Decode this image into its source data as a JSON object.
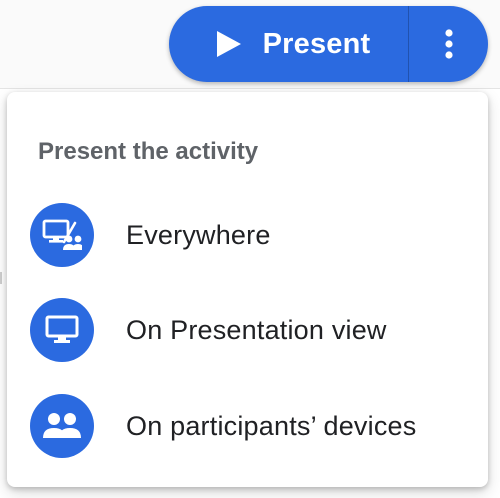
{
  "toolbar": {
    "present_label": "Present",
    "present_icon": "play-icon",
    "more_icon": "more-vert-icon",
    "accent_color": "#2b6ae0"
  },
  "menu": {
    "heading": "Present the activity",
    "items": [
      {
        "label": "Everywhere",
        "icon": "present-everywhere-icon"
      },
      {
        "label": "On Presentation view",
        "icon": "monitor-icon"
      },
      {
        "label": "On participants’ devices",
        "icon": "people-icon"
      }
    ]
  }
}
